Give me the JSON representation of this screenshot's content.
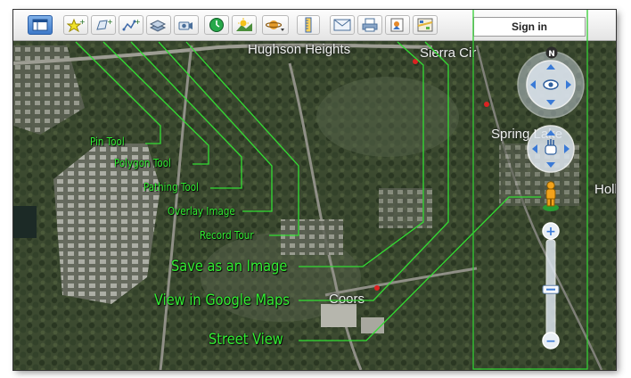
{
  "toolbar": {
    "items": [
      {
        "name": "sidebar-toggle-button",
        "icon": "panel-icon"
      },
      {
        "name": "pin-tool-button",
        "icon": "pin-icon"
      },
      {
        "name": "polygon-tool-button",
        "icon": "polygon-icon"
      },
      {
        "name": "pathing-tool-button",
        "icon": "path-icon"
      },
      {
        "name": "overlay-image-button",
        "icon": "overlay-icon"
      },
      {
        "name": "record-tour-button",
        "icon": "camera-icon"
      },
      {
        "name": "historical-imagery-button",
        "icon": "clock-icon"
      },
      {
        "name": "sunlight-button",
        "icon": "sun-icon"
      },
      {
        "name": "planet-switch-button",
        "icon": "planet-icon"
      },
      {
        "name": "ruler-button",
        "icon": "ruler-icon"
      },
      {
        "name": "email-button",
        "icon": "envelope-icon"
      },
      {
        "name": "print-button",
        "icon": "printer-icon"
      },
      {
        "name": "save-image-button",
        "icon": "save-image-icon"
      },
      {
        "name": "google-maps-button",
        "icon": "map-icon"
      }
    ],
    "sign_in_label": "Sign in"
  },
  "map": {
    "labels": [
      {
        "name": "place-label-hughson-heights",
        "text": "Hughson Heights"
      },
      {
        "name": "place-label-sierra-cir",
        "text": "Sierra Cir"
      },
      {
        "name": "place-label-spring-lake",
        "text": "Spring Lake"
      },
      {
        "name": "place-label-holl",
        "text": "Holl"
      },
      {
        "name": "place-label-coors",
        "text": "Coors"
      }
    ]
  },
  "navigation": {
    "north_label": "N",
    "zoom_in_label": "+",
    "zoom_out_label": "−",
    "zoom_level": 0.55
  },
  "callouts": [
    {
      "name": "callout-pin-tool",
      "text": "Pin Tool"
    },
    {
      "name": "callout-polygon-tool",
      "text": "Polygon Tool"
    },
    {
      "name": "callout-pathing-tool",
      "text": "Pathing Tool"
    },
    {
      "name": "callout-overlay-image",
      "text": "Overlay Image"
    },
    {
      "name": "callout-record-tour",
      "text": "Record Tour"
    },
    {
      "name": "callout-save-image",
      "text": "Save as an Image"
    },
    {
      "name": "callout-google-maps",
      "text": "View in Google Maps"
    },
    {
      "name": "callout-street-view",
      "text": "Street View"
    }
  ],
  "colors": {
    "callout": "#33ee33",
    "toolbar": "#eeeeee"
  }
}
